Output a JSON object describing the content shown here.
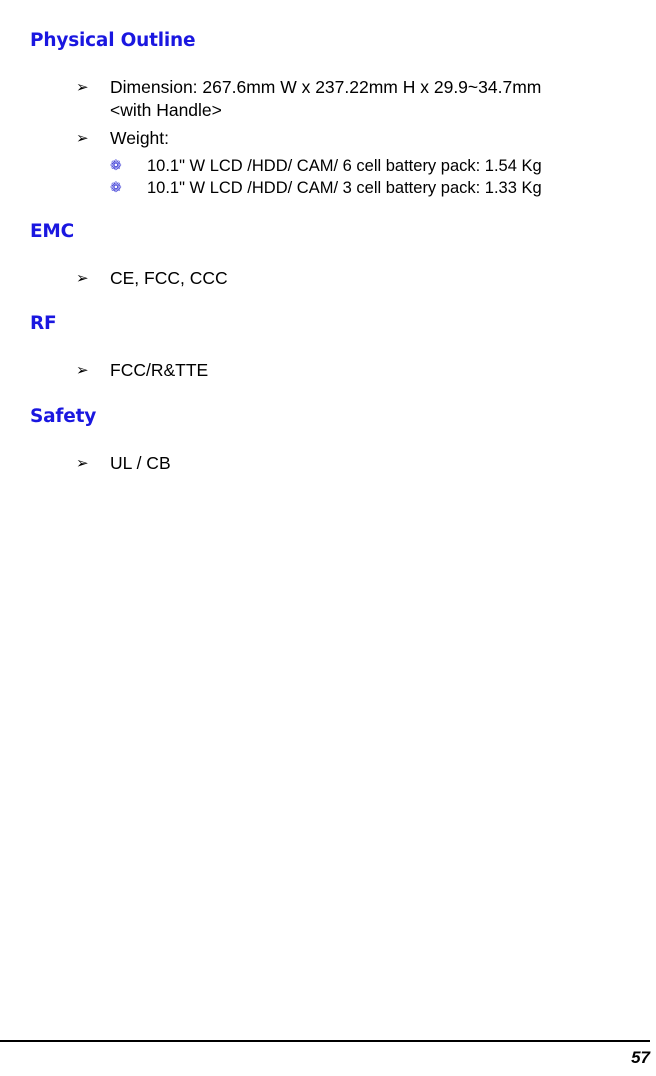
{
  "page": {
    "number": "57",
    "bullet_marker_l1": "➢",
    "bullet_marker_l2": "❁"
  },
  "sections": [
    {
      "id": "physical-outline",
      "heading": "Physical Outline",
      "items": [
        {
          "level": 1,
          "text": "Dimension: 267.6mm W x 237.22mm H x 29.9~34.7mm\n<with Handle>"
        },
        {
          "level": 1,
          "text": "Weight:"
        },
        {
          "level": 2,
          "text": "10.1\" W LCD /HDD/ CAM/ 6 cell battery pack: 1.54 Kg"
        },
        {
          "level": 2,
          "text": "10.1\" W LCD /HDD/ CAM/ 3 cell battery pack: 1.33 Kg"
        }
      ]
    },
    {
      "id": "emc",
      "heading": "EMC",
      "items": [
        {
          "level": 1,
          "text": "CE, FCC, CCC"
        }
      ]
    },
    {
      "id": "rf",
      "heading": "RF",
      "items": [
        {
          "level": 1,
          "text": "FCC/R&TTE"
        }
      ]
    },
    {
      "id": "safety",
      "heading": "Safety",
      "items": [
        {
          "level": 1,
          "text": "UL / CB"
        }
      ]
    }
  ],
  "colors": {
    "heading": "#1a17e0",
    "sub_bullet": "#3b3bd6",
    "body_text": "#000000",
    "page_background": "#ffffff"
  }
}
